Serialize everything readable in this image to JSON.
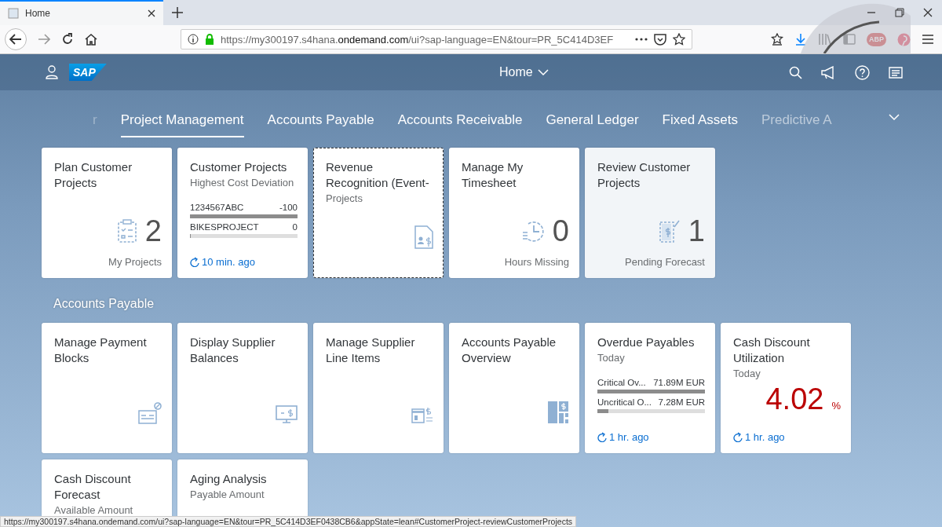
{
  "browser": {
    "tab": {
      "title": "Home"
    },
    "url": {
      "prefix": "https://my300197.s4hana.",
      "domain": "ondemand.com",
      "path": "/ui?sap-language=EN&tour=PR_5C414D3EF"
    },
    "adblock_badge": "ABP",
    "status_url": "https://my300197.s4hana.ondemand.com/ui?sap-language=EN&tour=PR_5C414D3EF0438CB6&appState=lean#CustomerProject-reviewCustomerProjects"
  },
  "shell": {
    "logo": "SAP",
    "title": "Home"
  },
  "anchor_bar": {
    "items": [
      {
        "label": "r",
        "selected": false
      },
      {
        "label": "Project Management",
        "selected": true
      },
      {
        "label": "Accounts Payable",
        "selected": false
      },
      {
        "label": "Accounts Receivable",
        "selected": false
      },
      {
        "label": "General Ledger",
        "selected": false
      },
      {
        "label": "Fixed Assets",
        "selected": false
      },
      {
        "label": "Predictive A",
        "selected": false
      }
    ]
  },
  "sections": [
    {
      "tiles": [
        {
          "kind": "numeric",
          "title": "Plan Customer Projects",
          "number": "2",
          "footer": "My Projects",
          "focused": false,
          "hovered": false
        },
        {
          "kind": "comparison",
          "title": "Customer Projects",
          "subtitle": "Highest Cost Deviation",
          "rows": [
            {
              "label": "1234567ABC",
              "value": "-100",
              "level": 1
            },
            {
              "label": "BIKESPROJECT",
              "value": "0",
              "level": 0
            }
          ],
          "refresh": "10 min. ago",
          "focused": false,
          "hovered": false
        },
        {
          "kind": "launch",
          "title": "Revenue Recognition (Event-",
          "subtitle": "Projects",
          "focused": true,
          "hovered": false
        },
        {
          "kind": "numeric",
          "title": "Manage My Timesheet",
          "number": "0",
          "footer": "Hours Missing",
          "focused": false,
          "hovered": false
        },
        {
          "kind": "numeric",
          "title": "Review Customer Projects",
          "number": "1",
          "footer": "Pending Forecast",
          "focused": false,
          "hovered": true
        }
      ]
    },
    {
      "title": "Accounts Payable",
      "tiles": [
        {
          "kind": "launch",
          "title": "Manage Payment Blocks",
          "focused": false,
          "hovered": false
        },
        {
          "kind": "launch",
          "title": "Display Supplier Balances",
          "focused": false,
          "hovered": false
        },
        {
          "kind": "launch",
          "title": "Manage Supplier Line Items",
          "focused": false,
          "hovered": false
        },
        {
          "kind": "launch",
          "title": "Accounts Payable Overview",
          "focused": false,
          "hovered": false
        },
        {
          "kind": "comparison",
          "title": "Overdue Payables",
          "subtitle": "Today",
          "rows": [
            {
              "label": "Critical Ov...",
              "value": "71.89M EUR",
              "level": 1
            },
            {
              "label": "Uncritical O...",
              "value": "7.28M EUR",
              "level": 0.1
            }
          ],
          "refresh": "1 hr. ago",
          "focused": false,
          "hovered": false
        },
        {
          "kind": "kpi",
          "title": "Cash Discount Utilization",
          "subtitle": "Today",
          "value": "4.02",
          "unit": "%",
          "refresh": "1 hr. ago",
          "focused": false,
          "hovered": false
        },
        {
          "kind": "launch",
          "title": "Cash Discount Forecast",
          "subtitle": "Available Amount",
          "focused": false,
          "hovered": false
        },
        {
          "kind": "launch",
          "title": "Aging Analysis",
          "subtitle": "Payable Amount",
          "focused": false,
          "hovered": false
        }
      ]
    }
  ]
}
